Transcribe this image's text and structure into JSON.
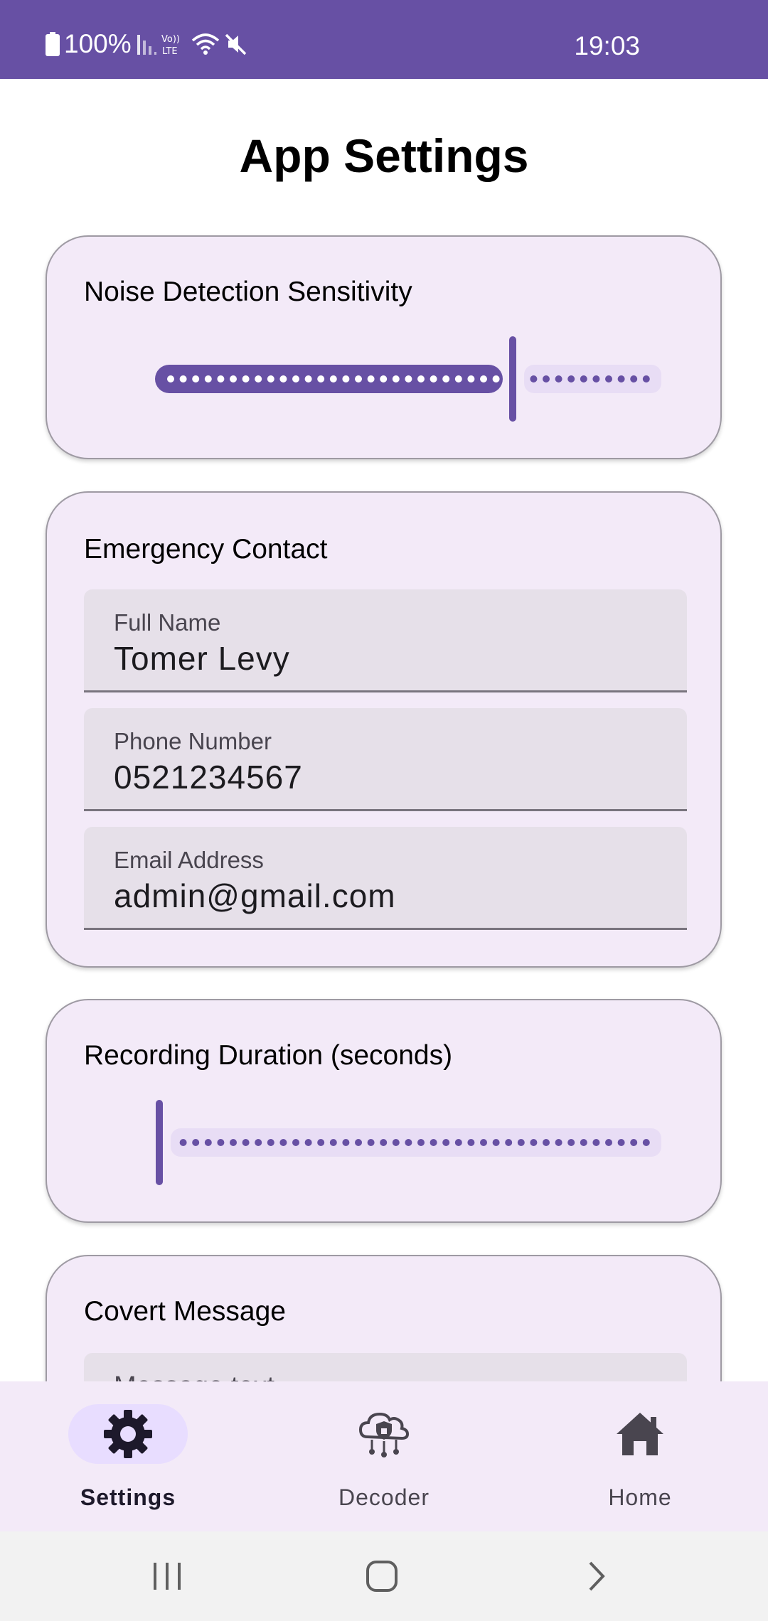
{
  "status_bar": {
    "battery": "100%",
    "time": "19:03",
    "icons": [
      "battery-icon",
      "signal-icon",
      "volte-icon",
      "wifi-icon",
      "mute-icon"
    ],
    "bg_color": "#6750a4"
  },
  "page": {
    "title": "App Settings"
  },
  "noise_card": {
    "title": "Noise Detection Sensitivity",
    "slider_value_fraction": 0.71
  },
  "contact_card": {
    "title": "Emergency Contact",
    "fields": [
      {
        "label": "Full Name",
        "value": "Tomer Levy"
      },
      {
        "label": "Phone Number",
        "value": "0521234567"
      },
      {
        "label": "Email Address",
        "value": "admin@gmail.com"
      }
    ]
  },
  "recording_card": {
    "title": "Recording Duration (seconds)",
    "slider_value_fraction": 0.0
  },
  "covert_card": {
    "title": "Covert Message",
    "field_placeholder": "Message text"
  },
  "bottom_nav": {
    "items": [
      {
        "label": "Settings",
        "icon": "gear-icon",
        "active": true
      },
      {
        "label": "Decoder",
        "icon": "cloud-shield-icon",
        "active": false
      },
      {
        "label": "Home",
        "icon": "home-icon",
        "active": false
      }
    ]
  },
  "system_nav": {
    "icons": [
      "recents-icon",
      "home-button-icon",
      "back-icon"
    ]
  },
  "colors": {
    "primary": "#6750a4",
    "card_bg": "#f3eaf8",
    "field_bg": "#e6e0e9",
    "track_inactive": "#e8ddf5"
  }
}
